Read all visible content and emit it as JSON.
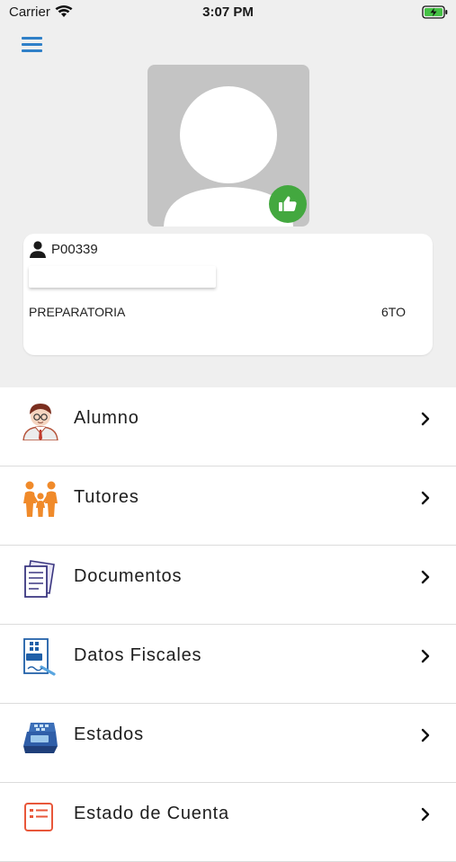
{
  "status": {
    "carrier": "Carrier",
    "time": "3:07 PM"
  },
  "profile": {
    "id": "P00339",
    "level": "PREPARATORIA",
    "grade": "6TO"
  },
  "menu": [
    {
      "label": "Alumno",
      "icon": "student-icon"
    },
    {
      "label": "Tutores",
      "icon": "family-icon"
    },
    {
      "label": "Documentos",
      "icon": "documents-icon"
    },
    {
      "label": "Datos Fiscales",
      "icon": "tax-data-icon"
    },
    {
      "label": "Estados",
      "icon": "register-icon"
    },
    {
      "label": "Estado de Cuenta",
      "icon": "account-statement-icon"
    }
  ],
  "colors": {
    "accent": "#2f80c8",
    "like": "#43a83f",
    "background": "#efefef",
    "orange": "#f08a2a"
  }
}
